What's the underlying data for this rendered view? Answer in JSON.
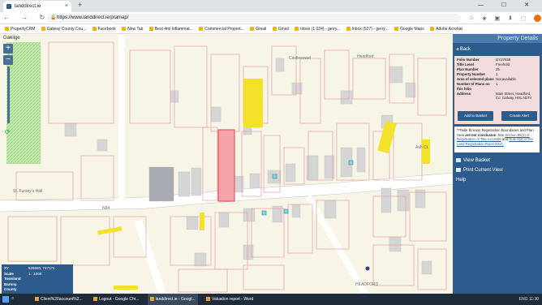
{
  "browser": {
    "tab_title": "landdirect.ie",
    "tab_close": "×",
    "new_tab": "+",
    "window_controls": "— ☐ ✕",
    "nav": "← → ↻ ⌂",
    "url": "https://www.landdirect.ie/pramap/",
    "lock": "🔒",
    "ext_icons": "☆ ◈ ▣ ⬇ ⬚",
    "bookmarks": [
      "PropertyCRM",
      "Galway County Cou...",
      "Facebook",
      "New Tab",
      "Best 4mi Inflammat...",
      "Commercial Propert...",
      "Gmail",
      "Gmail",
      "Inbox (1,024) - gerry...",
      "Inbox (527) - gerry...",
      "Google Maps",
      "Adobe Acrobat"
    ]
  },
  "map": {
    "language_link": "Gaeilge",
    "zoom_in": "+",
    "zoom_out": "−",
    "refresh": "⟳",
    "labels": {
      "headford": "Headford",
      "castlesowel": "Castlesowel",
      "st_furseys": "St. Fursey's Hall",
      "n84": "N84",
      "headford_bottom": "HEADFORD",
      "ashbrook": "Ash Ct."
    },
    "info": [
      {
        "k": "XY",
        "v": "526660, 747174"
      },
      {
        "k": "Scale",
        "v": "1 : 1000"
      },
      {
        "k": "Townland",
        "v": ""
      },
      {
        "k": "Barony",
        "v": ""
      },
      {
        "k": "County",
        "v": ""
      }
    ]
  },
  "panel": {
    "title": "Property Details",
    "back": "Back",
    "fields": [
      {
        "k": "Folio Number",
        "v": "GY27938"
      },
      {
        "k": "Title Level",
        "v": "Freehold"
      },
      {
        "k": "Plan Number",
        "v": "25"
      },
      {
        "k": "Property Number",
        "v": "1"
      },
      {
        "k": "Area of selected plans",
        "v": "Not available."
      },
      {
        "k": "Number of Plans on this folio",
        "v": "1"
      },
      {
        "k": "Address",
        "v": "Main Street, Headford, Co. Galway, H91 AD7V"
      }
    ],
    "add_basket": "Add to Basket",
    "create_alert": "Create Alert",
    "note_a": "**Tailte Éireann Registration Boundaries and Plan Area ",
    "note_bold": "are not conclusive",
    "note_b": ". See ",
    "note_link1": "Section 85(3) of Registration of Title Act 2006",
    "note_c": " and ",
    "note_link2": "Rule 8(3) of the Land Registration Rules 2012.",
    "view_basket": "View Basket",
    "print_view": "Print Current View",
    "help": "Help"
  },
  "taskbar": {
    "search": "⌕",
    "items": [
      "Client%20account%2...",
      "Logout - Google Chr...",
      "landdirect.ie - Googl...",
      "Valuation report - Word"
    ],
    "tray": "ENG  11:30"
  }
}
